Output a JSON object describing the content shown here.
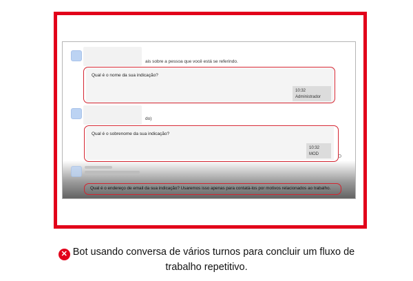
{
  "chat": {
    "message1_partial": "ais sobre a pessoa que você está se referindo.",
    "bubble1_question": "Qual é o nome da sua indicação?",
    "bubble1_time": "10:32",
    "bubble1_sender": "Administrador",
    "message2_partial": "do)",
    "bubble2_question": "Qual é o sobrenome da sua indicação?",
    "bubble2_time": "10:32",
    "bubble2_sender": "MOD",
    "bubble3_question": "Qual é o endereço de email da sua indicação? Usaremos isso apenas para contatá-los por motivos relacionados ao trabalho."
  },
  "caption": {
    "icon": "x-circle-icon",
    "line1": "Bot usando conversa de vários turnos para concluir um fluxo de",
    "line2": "trabalho repetitivo."
  },
  "colors": {
    "frame_red": "#e2001a",
    "highlight_red": "#d4232f"
  }
}
